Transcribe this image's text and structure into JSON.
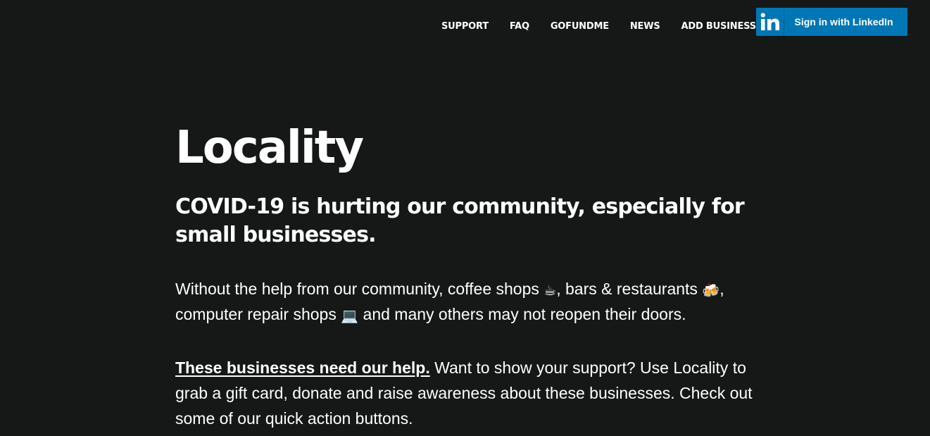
{
  "nav": {
    "links": [
      {
        "label": "SUPPORT"
      },
      {
        "label": "FAQ"
      },
      {
        "label": "GOFUNDME"
      },
      {
        "label": "NEWS"
      },
      {
        "label": "ADD BUSINESS"
      }
    ],
    "linkedin": {
      "logo_text": "in",
      "label": "Sign in with LinkedIn",
      "brand_color": "#0077b5",
      "icon": "linkedin-icon"
    }
  },
  "hero": {
    "title": "Locality",
    "tagline": "COVID-19 is hurting our community, especially for small businesses.",
    "para1": {
      "part1": "Without the help from our community, coffee shops ",
      "emoji1": "☕",
      "part2": ", bars & restaurants ",
      "emoji2": "🍻",
      "part3": ", computer repair shops ",
      "emoji3": "💻",
      "part4": " and many others may not reopen their doors."
    },
    "para2": {
      "link": "These businesses need our help.",
      "text": " Want to show your support? Use Locality to grab a gift card, donate and raise awareness about these businesses. Check out some of our quick action buttons."
    }
  },
  "colors": {
    "background": "#161717",
    "text": "#ffffff",
    "linkedin_blue": "#0077b5"
  }
}
